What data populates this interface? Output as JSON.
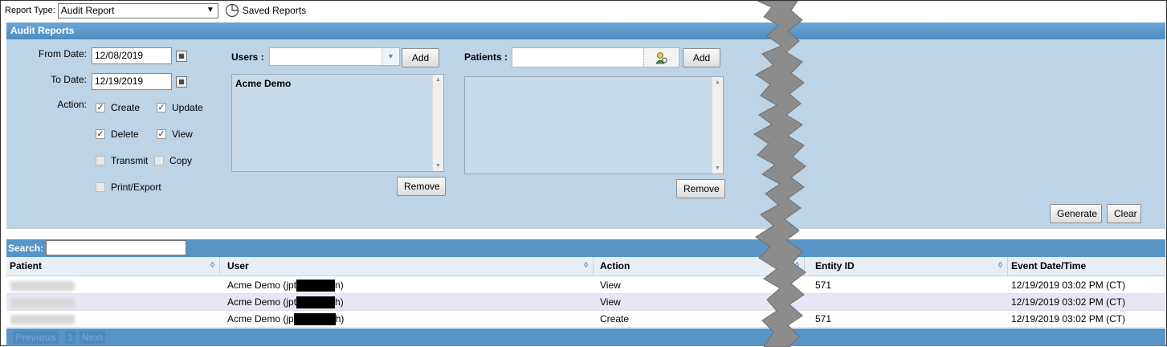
{
  "topbar": {
    "report_type_label": "Report Type:",
    "report_type_value": "Audit Report",
    "saved_reports": "Saved Reports"
  },
  "panel": {
    "title": "Audit Reports",
    "from_date_label": "From Date:",
    "from_date": "12/08/2019",
    "to_date_label": "To Date:",
    "to_date": "12/19/2019",
    "action_label": "Action:",
    "actions": [
      {
        "label": "Create",
        "checked": true
      },
      {
        "label": "Update",
        "checked": true
      },
      {
        "label": "Delete",
        "checked": true
      },
      {
        "label": "View",
        "checked": true
      },
      {
        "label": "Transmit",
        "checked": false
      },
      {
        "label": "Copy",
        "checked": false
      },
      {
        "label": "Print/Export",
        "checked": false
      }
    ],
    "users_label": "Users :",
    "users_add": "Add",
    "users_list": [
      "Acme Demo"
    ],
    "users_remove": "Remove",
    "patients_label": "Patients :",
    "patients_add": "Add",
    "patients_remove": "Remove",
    "generate": "Generate",
    "clear": "Clear"
  },
  "search": {
    "label": "Search:"
  },
  "table": {
    "columns": [
      "Patient",
      "User",
      "Action",
      "Entity ID",
      "Event Date/Time"
    ],
    "rows": [
      {
        "user_a": "Acme Demo (jpt",
        "user_b": "n)",
        "action": "View",
        "entity": "571",
        "time": "12/19/2019 03:02 PM (CT)"
      },
      {
        "user_a": "Acme Demo (jpt",
        "user_b": "h)",
        "action": "View",
        "entity": "",
        "time": "12/19/2019 03:02 PM (CT)"
      },
      {
        "user_a": "Acme Demo (jp",
        "user_b": "h)",
        "action": "Create",
        "entity": "571",
        "time": "12/19/2019 03:02 PM (CT)"
      }
    ]
  },
  "pager": {
    "previous": "Previous",
    "page": "1",
    "next": "Next"
  }
}
